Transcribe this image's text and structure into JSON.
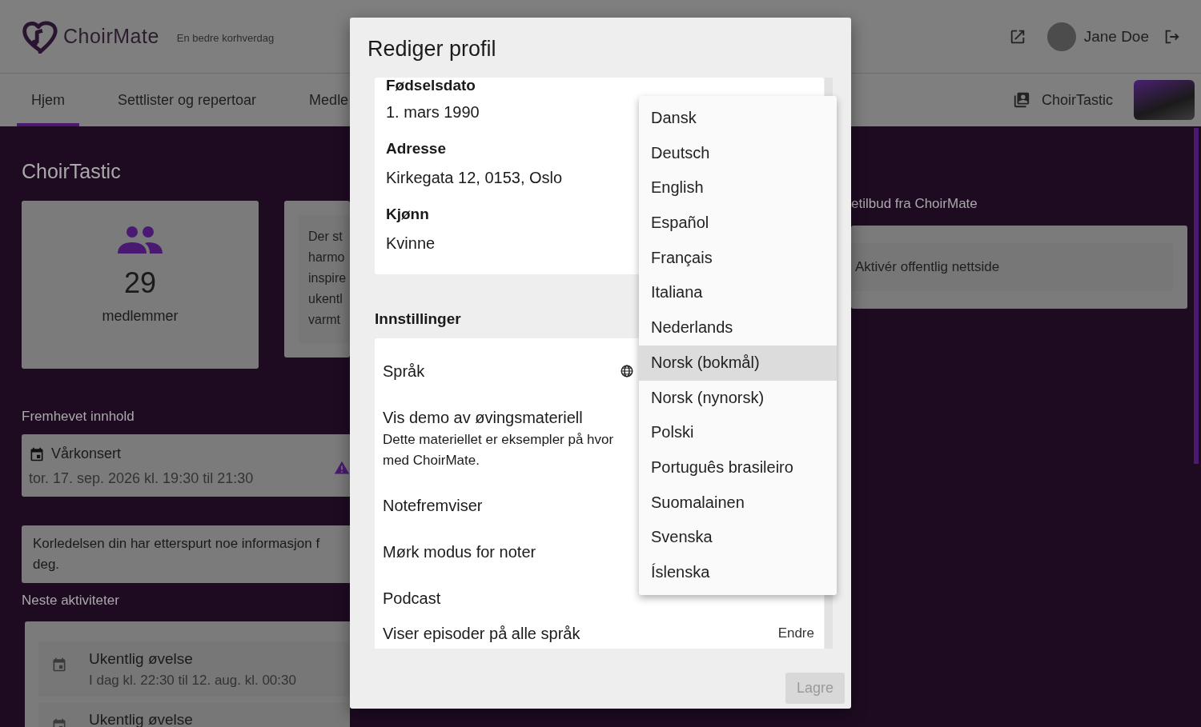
{
  "header": {
    "logo": "ChoirMate",
    "tagline": "En bedre korhverdag",
    "user": "Jane Doe"
  },
  "nav": {
    "tabs": [
      {
        "label": "Hjem",
        "selected": true
      },
      {
        "label": "Settlister og repertoar",
        "selected": false
      },
      {
        "label": "Medle",
        "selected": false
      }
    ],
    "choir": "ChoirTastic"
  },
  "home": {
    "title": "ChoirTastic",
    "members_count": "29",
    "members_label": "medlemmer",
    "about_lines": [
      "Der st",
      "harmo",
      "inspire",
      "ukentl",
      "varmt"
    ],
    "featured_heading": "Fremhevet innhold",
    "featured": {
      "title": "Vårkonsert",
      "time": "tor. 17. sep. 2026 kl. 19:30 til 21:30"
    },
    "notice_lines": [
      "Korledelsen din har etterspurt noe informasjon f",
      "deg."
    ],
    "activities_heading": "Neste aktiviteter",
    "activities": [
      {
        "title": "Ukentlig øvelse",
        "time": "I dag kl. 22:30 til 12. aug. kl. 00:30"
      },
      {
        "title": "Ukentlig øvelse"
      }
    ]
  },
  "offers": {
    "heading": "etilbud fra ChoirMate",
    "items": [
      "Aktivér offentlig nettside"
    ]
  },
  "dialog": {
    "title": "Rediger profil",
    "profile_fields": [
      {
        "label": "Fødselsdato",
        "value": "1. mars 1990"
      },
      {
        "label": "Adresse",
        "value": "Kirkegata 12, 0153, Oslo"
      },
      {
        "label": "Kjønn",
        "value": "Kvinne"
      }
    ],
    "settings_heading": "Innstillinger",
    "settings": [
      {
        "kind": "select",
        "label": "Språk"
      },
      {
        "kind": "plain",
        "label": "Vis demo av øvingsmateriell",
        "description_lines": [
          "Dette materiellet er eksempler på hvor",
          "med ChoirMate."
        ]
      },
      {
        "kind": "plain",
        "label": "Notefremviser"
      },
      {
        "kind": "plain",
        "label": "Mørk modus for noter"
      },
      {
        "kind": "plain",
        "label": "Podcast"
      },
      {
        "kind": "link",
        "label": "Viser episoder på alle språk",
        "action": "Endre"
      }
    ],
    "language_menu": [
      {
        "label": "Dansk",
        "selected": false
      },
      {
        "label": "Deutsch",
        "selected": false
      },
      {
        "label": "English",
        "selected": false
      },
      {
        "label": "Español",
        "selected": false
      },
      {
        "label": "Français",
        "selected": false
      },
      {
        "label": "Italiana",
        "selected": false
      },
      {
        "label": "Nederlands",
        "selected": false
      },
      {
        "label": "Norsk (bokmål)",
        "selected": true
      },
      {
        "label": "Norsk (nynorsk)",
        "selected": false
      },
      {
        "label": "Polski",
        "selected": false
      },
      {
        "label": "Português brasileiro",
        "selected": false
      },
      {
        "label": "Suomalainen",
        "selected": false
      },
      {
        "label": "Svenska",
        "selected": false
      },
      {
        "label": "Íslenska",
        "selected": false
      }
    ],
    "save": {
      "label": "Lagre",
      "disabled": true
    }
  }
}
